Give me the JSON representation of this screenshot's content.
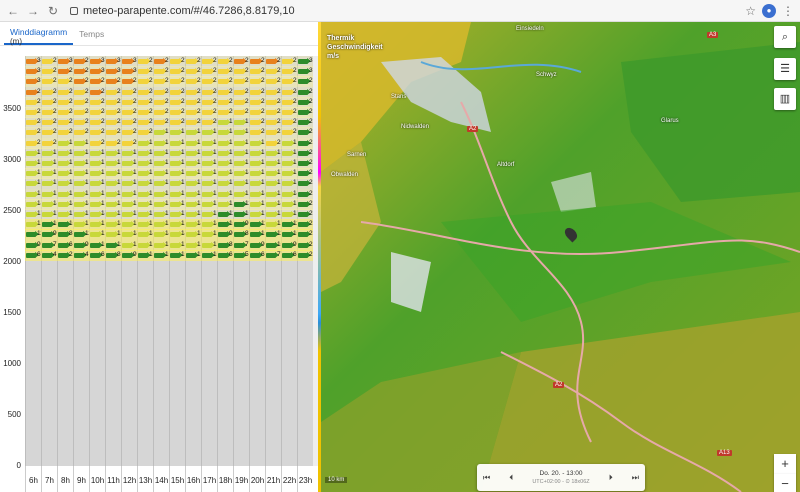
{
  "browser": {
    "url": "meteo-parapente.com/#/46.7286,8.8179,10"
  },
  "tabs": [
    {
      "label": "Winddiagramm",
      "active": true
    },
    {
      "label": "Temps",
      "active": false
    }
  ],
  "chart": {
    "unit_label": "(m)",
    "y_ticks": [
      "3500",
      "3000",
      "2500",
      "2000",
      "1500",
      "1000",
      "500",
      "0"
    ],
    "hours": [
      "6h",
      "7h",
      "8h",
      "9h",
      "10h",
      "11h",
      "12h",
      "13h",
      "14h",
      "15h",
      "16h",
      "17h",
      "18h",
      "19h",
      "20h",
      "21h",
      "22h",
      "23h"
    ],
    "wind_rows": [
      [
        "34",
        "26",
        "30",
        "29",
        "31",
        "31",
        "32",
        "27",
        "29",
        "27",
        "26",
        "26",
        "26",
        "29",
        "29",
        "28",
        "27",
        "3"
      ],
      [
        "33",
        "26",
        "29",
        "29",
        "30",
        "30",
        "30",
        "26",
        "27",
        "26",
        "26",
        "26",
        "24",
        "27",
        "27",
        "27",
        "26",
        "3"
      ],
      [
        "32",
        "25",
        "27",
        "28",
        "29",
        "28",
        "28",
        "25",
        "26",
        "25",
        "25",
        "25",
        "23",
        "25",
        "26",
        "26",
        "25",
        "2"
      ],
      [
        "29",
        "24",
        "26",
        "26",
        "28",
        "26",
        "27",
        "24",
        "24",
        "24",
        "23",
        "24",
        "22",
        "23",
        "25",
        "25",
        "24",
        "2"
      ],
      [
        "27",
        "24",
        "25",
        "25",
        "26",
        "25",
        "25",
        "23",
        "23",
        "23",
        "22",
        "22",
        "21",
        "22",
        "23",
        "24",
        "23",
        "2"
      ],
      [
        "26",
        "23",
        "24",
        "24",
        "24",
        "24",
        "23",
        "22",
        "22",
        "21",
        "21",
        "21",
        "20",
        "21",
        "22",
        "23",
        "22",
        "2"
      ],
      [
        "24",
        "22",
        "22",
        "22",
        "22",
        "22",
        "22",
        "21",
        "21",
        "20",
        "20",
        "20",
        "19",
        "19",
        "21",
        "22",
        "21",
        "2"
      ],
      [
        "23",
        "21",
        "20",
        "20",
        "21",
        "21",
        "21",
        "20",
        "19",
        "19",
        "18",
        "19",
        "18",
        "18",
        "20",
        "21",
        "20",
        "2"
      ],
      [
        "21",
        "20",
        "19",
        "19",
        "20",
        "20",
        "20",
        "19",
        "18",
        "18",
        "17",
        "18",
        "17",
        "17",
        "19",
        "20",
        "19",
        "2"
      ],
      [
        "19",
        "19",
        "18",
        "18",
        "18",
        "19",
        "19",
        "18",
        "17",
        "17",
        "17",
        "17",
        "16",
        "16",
        "18",
        "19",
        "18",
        "2"
      ],
      [
        "18",
        "18",
        "17",
        "17",
        "17",
        "18",
        "18",
        "17",
        "17",
        "17",
        "16",
        "16",
        "15",
        "15",
        "17",
        "18",
        "17",
        "2"
      ],
      [
        "17",
        "17",
        "16",
        "16",
        "17",
        "17",
        "17",
        "16",
        "16",
        "17",
        "16",
        "15",
        "14",
        "14",
        "16",
        "17",
        "16",
        "2"
      ],
      [
        "16",
        "16",
        "16",
        "16",
        "16",
        "16",
        "16",
        "16",
        "16",
        "16",
        "15",
        "15",
        "13",
        "13",
        "15",
        "16",
        "15",
        "2"
      ],
      [
        "15",
        "15",
        "15",
        "15",
        "15",
        "16",
        "16",
        "16",
        "16",
        "16",
        "15",
        "15",
        "13",
        "12",
        "14",
        "15",
        "14",
        "2"
      ],
      [
        "14",
        "14",
        "14",
        "14",
        "15",
        "15",
        "16",
        "16",
        "16",
        "16",
        "15",
        "15",
        "12",
        "11",
        "13",
        "14",
        "13",
        "2"
      ],
      [
        "13",
        "12",
        "12",
        "13",
        "14",
        "15",
        "15",
        "16",
        "16",
        "16",
        "15",
        "15",
        "11",
        "10",
        "12",
        "13",
        "12",
        "2"
      ],
      [
        "12",
        "10",
        "10",
        "12",
        "13",
        "14",
        "15",
        "15",
        "15",
        "15",
        "14",
        "14",
        "10",
        "9",
        "11",
        "12",
        "11",
        "2"
      ],
      [
        "11",
        "9",
        "8",
        "11",
        "12",
        "13",
        "14",
        "14",
        "14",
        "14",
        "13",
        "13",
        "9",
        "8",
        "10",
        "11",
        "10",
        "2"
      ],
      [
        "9",
        "7",
        "6",
        "9",
        "10",
        "11",
        "12",
        "13",
        "13",
        "13",
        "12",
        "12",
        "8",
        "7",
        "9",
        "10",
        "9",
        "2"
      ],
      [
        "6",
        "4",
        "2",
        "4",
        "6",
        "8",
        "9",
        "10",
        "10",
        "10",
        "10",
        "10",
        "6",
        "5",
        "6",
        "7",
        "6",
        "2"
      ]
    ],
    "arrow_colors": {
      "strong": "#e8811c",
      "medium": "#f2d33b",
      "light": "#c8d83a",
      "calm": "#2e8c2a"
    }
  },
  "map": {
    "legend_title": "Thermik",
    "legend_sub": "Geschwindigkeit",
    "legend_unit": "m/s",
    "places": [
      "Einsiedeln",
      "Schwyz",
      "Altdorf",
      "Sarnen",
      "Obwalden",
      "Stans",
      "Nidwalden",
      "Glarus"
    ],
    "road_badges": [
      "A2",
      "A2",
      "A3",
      "A13"
    ],
    "time_label": "Do. 20. - 13:00",
    "time_sub": "UTC+02:00 - ⏲ 18x06Z",
    "scale": "10 km"
  },
  "controls": {
    "search_icon": "search-icon",
    "settings_icon": "sliders-icon",
    "chart_icon": "chart-icon",
    "zoom_in": "+",
    "zoom_out": "−"
  }
}
